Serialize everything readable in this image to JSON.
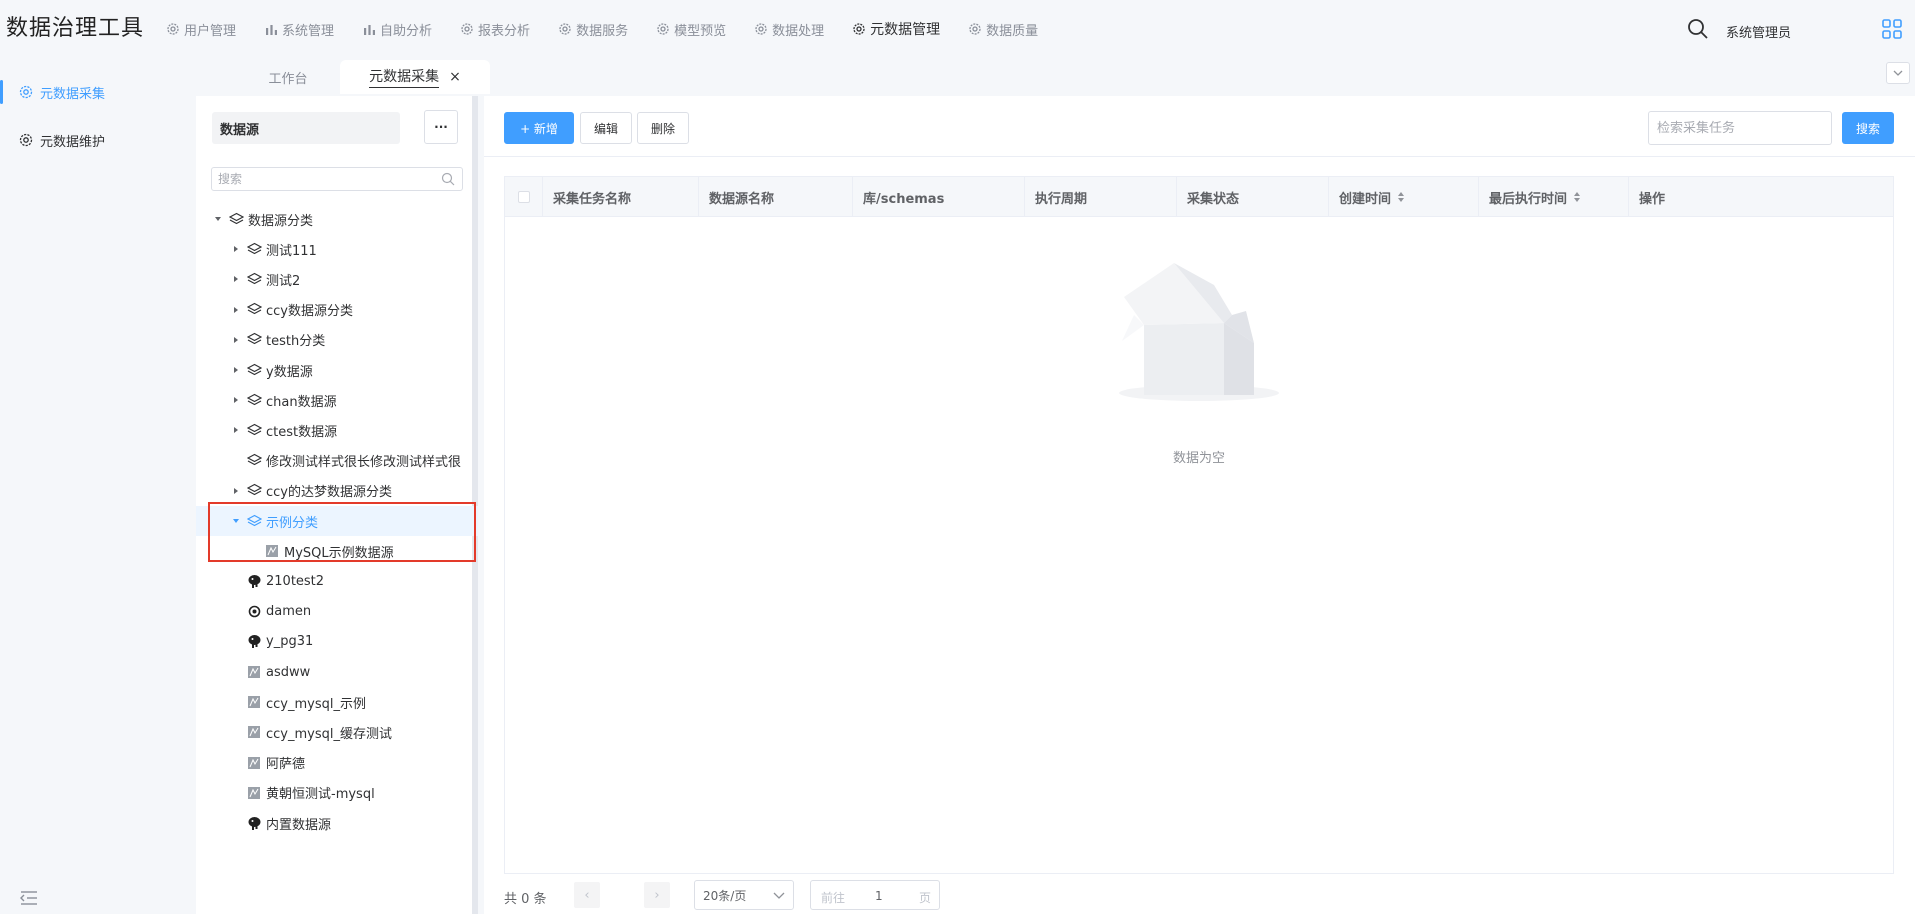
{
  "app": {
    "title": "数据治理工具"
  },
  "nav": [
    {
      "label": "用户管理",
      "icon": "gear-icon"
    },
    {
      "label": "系统管理",
      "icon": "bar-chart-icon"
    },
    {
      "label": "自助分析",
      "icon": "bar-chart-icon"
    },
    {
      "label": "报表分析",
      "icon": "gear-icon"
    },
    {
      "label": "数据服务",
      "icon": "gear-icon"
    },
    {
      "label": "模型预览",
      "icon": "gear-icon"
    },
    {
      "label": "数据处理",
      "icon": "gear-icon"
    },
    {
      "label": "元数据管理",
      "icon": "gear-icon",
      "active": true
    },
    {
      "label": "数据质量",
      "icon": "gear-icon"
    }
  ],
  "user": {
    "name": "系统管理员"
  },
  "side_menu": [
    {
      "label": "元数据采集",
      "active": true
    },
    {
      "label": "元数据维护"
    }
  ],
  "tabs": {
    "workbench": "工作台",
    "active": "元数据采集",
    "close": "×"
  },
  "tree_panel": {
    "title": "数据源",
    "more": "···",
    "search_placeholder": "搜索",
    "nodes": [
      {
        "label": "数据源分类",
        "level": 0,
        "arrow": "down",
        "icon": "layers-icon"
      },
      {
        "label": "测试111",
        "level": 1,
        "arrow": "right",
        "icon": "layers-icon"
      },
      {
        "label": "测试2",
        "level": 1,
        "arrow": "right",
        "icon": "layers-icon"
      },
      {
        "label": "ccy数据源分类",
        "level": 1,
        "arrow": "right",
        "icon": "layers-icon"
      },
      {
        "label": "testh分类",
        "level": 1,
        "arrow": "right",
        "icon": "layers-icon"
      },
      {
        "label": "y数据源",
        "level": 1,
        "arrow": "right",
        "icon": "layers-icon"
      },
      {
        "label": "chan数据源",
        "level": 1,
        "arrow": "right",
        "icon": "layers-icon"
      },
      {
        "label": "ctest数据源",
        "level": 1,
        "arrow": "right",
        "icon": "layers-icon"
      },
      {
        "label": "修改测试样式很长修改测试样式很",
        "level": 1,
        "arrow": "none",
        "icon": "layers-icon"
      },
      {
        "label": "ccy的达梦数据源分类",
        "level": 1,
        "arrow": "right",
        "icon": "layers-icon"
      },
      {
        "label": "示例分类",
        "level": 1,
        "arrow": "down",
        "icon": "layers-icon",
        "selected": true
      },
      {
        "label": "MySQL示例数据源",
        "level": 2,
        "arrow": "none",
        "icon": "mysql-icon"
      },
      {
        "label": "210test2",
        "level": 1,
        "arrow": "none",
        "icon": "postgres-icon"
      },
      {
        "label": "damen",
        "level": 1,
        "arrow": "none",
        "icon": "dameng-icon"
      },
      {
        "label": "y_pg31",
        "level": 1,
        "arrow": "none",
        "icon": "postgres-icon"
      },
      {
        "label": "asdww",
        "level": 1,
        "arrow": "none",
        "icon": "mysql-icon"
      },
      {
        "label": "ccy_mysql_示例",
        "level": 1,
        "arrow": "none",
        "icon": "mysql-icon"
      },
      {
        "label": "ccy_mysql_缓存测试",
        "level": 1,
        "arrow": "none",
        "icon": "mysql-icon"
      },
      {
        "label": "阿萨德",
        "level": 1,
        "arrow": "none",
        "icon": "mysql-icon"
      },
      {
        "label": "黄朝恒测试-mysql",
        "level": 1,
        "arrow": "none",
        "icon": "mysql-icon"
      },
      {
        "label": "内置数据源",
        "level": 1,
        "arrow": "none",
        "icon": "postgres-icon"
      }
    ]
  },
  "toolbar": {
    "add": "+ 新增",
    "edit": "编辑",
    "delete": "删除",
    "search_placeholder": "检索采集任务",
    "search": "搜索"
  },
  "table": {
    "columns": [
      {
        "label": "采集任务名称"
      },
      {
        "label": "数据源名称"
      },
      {
        "label": "库/schemas"
      },
      {
        "label": "执行周期"
      },
      {
        "label": "采集状态"
      },
      {
        "label": "创建时间",
        "sortable": true
      },
      {
        "label": "最后执行时间",
        "sortable": true
      },
      {
        "label": "操作"
      }
    ],
    "rows": [],
    "empty_text": "数据为空"
  },
  "pagination": {
    "total": "共 0 条",
    "prev": "‹",
    "next": "›",
    "page_size": "20条/页",
    "goto_prefix": "前往",
    "current_page": "1",
    "goto_suffix": "页"
  },
  "colors": {
    "primary": "#409eff",
    "annotation": "#e33a2a"
  }
}
